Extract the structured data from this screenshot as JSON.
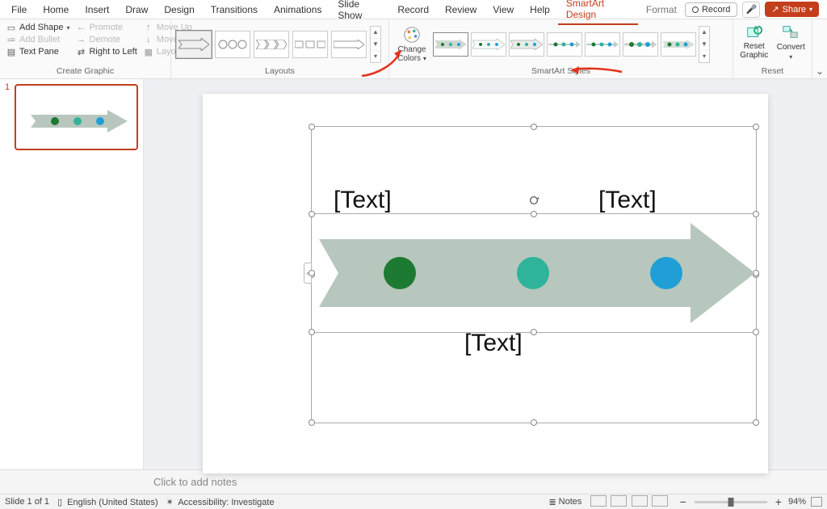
{
  "tabs": {
    "items": [
      "File",
      "Home",
      "Insert",
      "Draw",
      "Design",
      "Transitions",
      "Animations",
      "Slide Show",
      "Record",
      "Review",
      "View",
      "Help",
      "SmartArt Design",
      "Format"
    ],
    "active": "SmartArt Design"
  },
  "titlebar": {
    "record": "Record",
    "share": "Share"
  },
  "ribbon": {
    "create_graphic": {
      "label": "Create Graphic",
      "add_shape": "Add Shape",
      "add_bullet": "Add Bullet",
      "text_pane": "Text Pane",
      "promote": "Promote",
      "demote": "Demote",
      "rtl": "Right to Left",
      "move_up": "Move Up",
      "move_down": "Move Down",
      "layout": "Layout"
    },
    "layouts": {
      "label": "Layouts"
    },
    "change_colors": {
      "line1": "Change",
      "line2": "Colors"
    },
    "styles": {
      "label": "SmartArt Styles"
    },
    "reset": {
      "label": "Reset",
      "reset_graphic": "Reset Graphic",
      "convert": "Convert"
    }
  },
  "slide": {
    "number": "1",
    "placeholders": {
      "t1": "[Text]",
      "t2": "[Text]",
      "t3": "[Text]"
    },
    "colors": {
      "arrow": "#b8c7bd",
      "dot1": "#1d7a33",
      "dot2": "#2fb39a",
      "dot3": "#1f9fd6"
    }
  },
  "notes": {
    "placeholder": "Click to add notes"
  },
  "status": {
    "slide_of": "Slide 1 of 1",
    "language": "English (United States)",
    "accessibility": "Accessibility: Investigate",
    "notes_btn": "Notes",
    "zoom": "94%"
  }
}
